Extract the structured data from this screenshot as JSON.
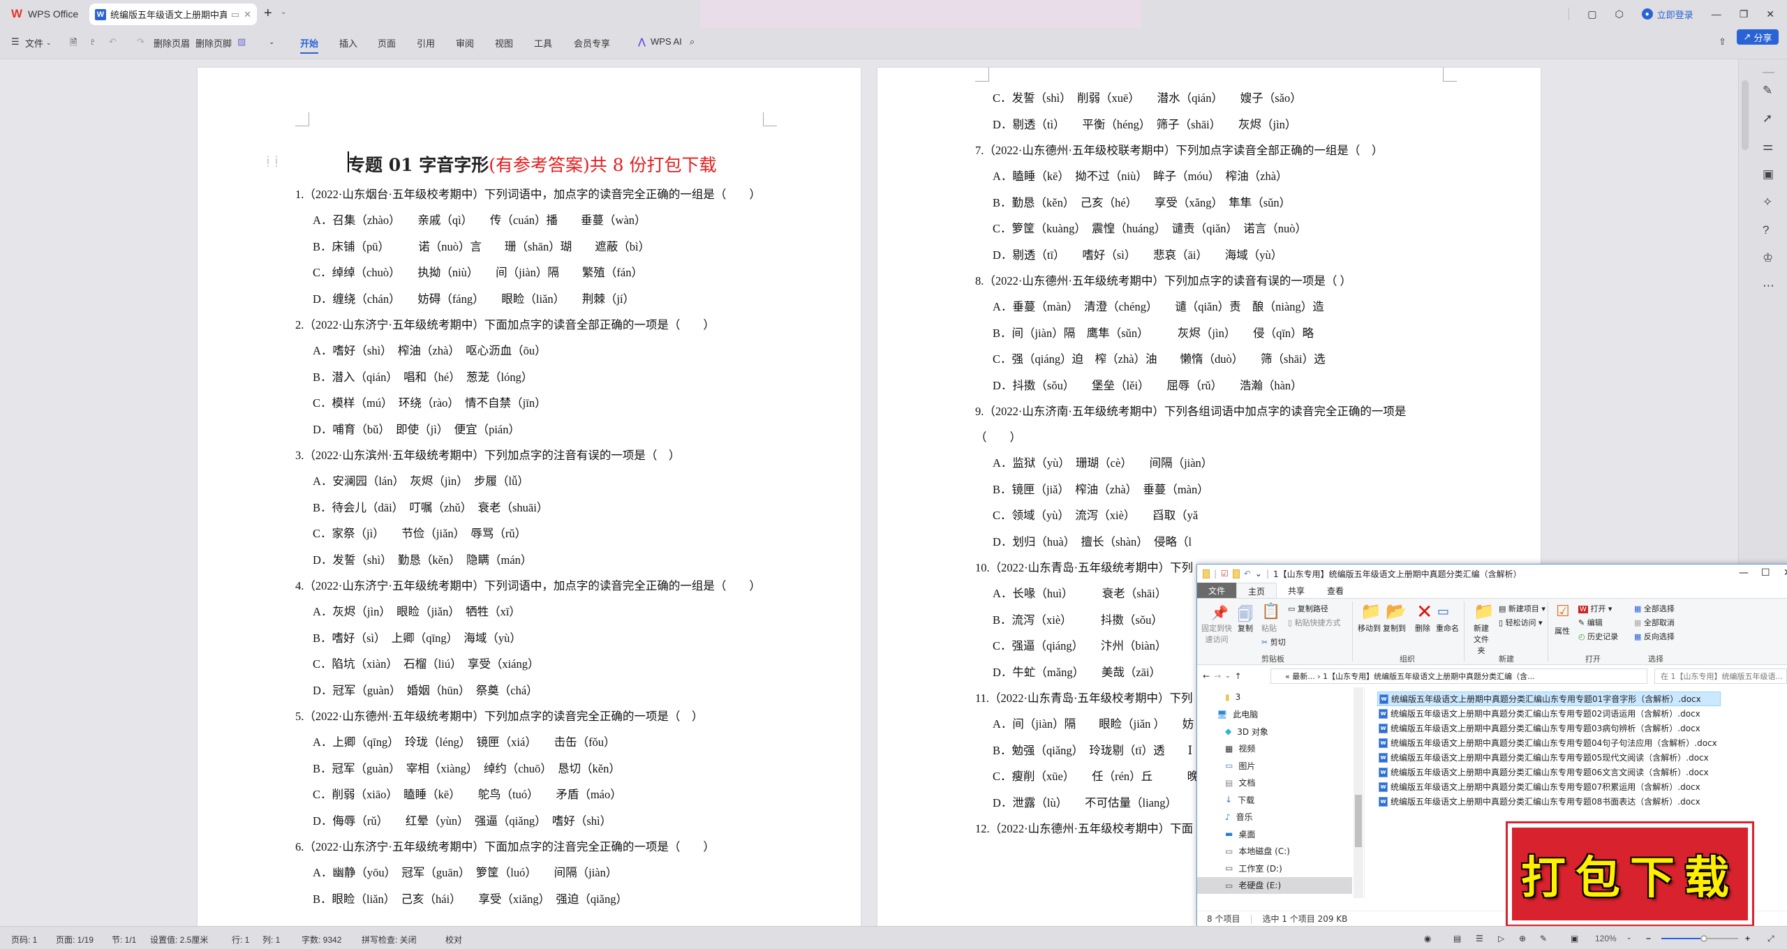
{
  "app": {
    "name": "WPS Office",
    "tab_title": "统编版五年级语文上册期中真题",
    "login_label": "立即登录",
    "share_label": "分享"
  },
  "toolbar": {
    "menu_file": "文件",
    "delete_header": "删除页眉",
    "delete_footer": "删除页脚",
    "tabs": [
      "开始",
      "插入",
      "页面",
      "引用",
      "审阅",
      "视图",
      "工具",
      "会员专享"
    ],
    "active_tab": "开始",
    "wps_ai": "WPS AI"
  },
  "document": {
    "title_black": "专题 01  字音字形",
    "title_red": "(有参考答案)共 8 份打包下载",
    "page1": [
      {
        "q": "1.（2022·山东烟台·五年级校考期中）下列词语中，加点字的读音完全正确的一组是（　　）",
        "options": [
          "A．召集（zhào）　　亲戚（qì）　　传（cuán）播　　垂蔓（wàn）",
          "B．床铺（pū）　　　诺（nuò）言　　珊（shān）瑚　　遮蔽（bì）",
          "C．绰绰（chuò）　　执拗（niù）　　间（jiàn）隔　　繁殖（fán）",
          "D．缠绕（chán）　　妨碍（fáng）　　眼睑（liǎn）　　荆棘（jí）"
        ]
      },
      {
        "q": "2.（2022·山东济宁·五年级统考期中）下面加点字的读音全部正确的一项是（　　）",
        "options": [
          "A．嗜好（shì）　榨油（zhà）　呕心沥血（ōu）",
          "B．潜入（qián）　唱和（hé）　葱茏（lóng）",
          "C．模样（mú）　环绕（rào）　情不自禁（jīn）",
          "D．哺育（bǔ）　即使（jì）　便宜（pián）"
        ]
      },
      {
        "q": "3.（2022·山东滨州·五年级统考期中）下列加点字的注音有误的一项是（　）",
        "options": [
          "A．安澜园（lán）　灰烬（jìn）　步履（lǚ）",
          "B．待会儿（dāi）　叮嘱（zhǔ）　衰老（shuāi）",
          "C．家祭（jì）　　节俭（jiǎn）　辱骂（rǔ）",
          "D．发誓（shì）　勤恳（kěn）　隐瞒（mán）"
        ]
      },
      {
        "q": "4.（2022·山东济宁·五年级统考期中）下列词语中，加点字的读音完全正确的一组是（　　）",
        "options": [
          "A．灰烬（jìn）　眼睑（jiǎn）　牺牲（xī）",
          "B．嗜好（sì）　上卿（qīng）　海域（yù）",
          "C．陷坑（xiàn）　石榴（liú）　享受（xiáng）",
          "D．冠军（guàn）　婚姻（hūn）　祭奠（chá）"
        ]
      },
      {
        "q": "5.（2022·山东德州·五年级统考期中）下列加点字的读音完全正确的一项是（　）",
        "options": [
          "A．上卿（qīng）　玲珑（léng）　镜匣（xiá）　　击缶（fǒu）",
          "B．冠军（guàn）　宰相（xiàng）　绰约（chuō）　恳切（kěn）",
          "C．削弱（xiāo）　瞌睡（kē）　　鸵鸟（tuó）　　矛盾（máo）",
          "D．侮辱（rǔ）　　红晕（yùn）　强逼（qiǎng）　嗜好（shì）"
        ]
      },
      {
        "q": "6.（2022·山东济宁·五年级统考期中）下面加点字的注音完全正确的一项是（　　）",
        "options": [
          "A．幽静（yōu）　冠军（guān）　箩筐（luó）　　间隔（jiàn）",
          "B．眼睑（liǎn）　己亥（hái）　　享受（xiǎng）　强迫（qiǎng）"
        ]
      }
    ],
    "page2_top": [
      "C．发誓（shì）　削弱（xuē）　　潜水（qián）　　嫂子（sǎo）",
      "D．剔透（tì）　　平衡（héng）　筛子（shāi）　　灰烬（jìn）"
    ],
    "page2": [
      {
        "q": "7.（2022·山东德州·五年级校联考期中）下列加点字读音全部正确的一组是（　）",
        "options": [
          "A．瞌睡（kē）　拗不过（niù）　眸子（móu）　榨油（zhà）",
          "B．勤恳（kěn）　己亥（hé）　　享受（xǎng）　隼隼（sǔn）",
          "C．箩筐（kuàng）　震惶（huáng）　谴责（qiǎn）　诺言（nuò）",
          "D．剔透（tī）　　嗜好（sì）　　悲哀（āi）　　海域（yù）"
        ]
      },
      {
        "q": "8.（2022·山东德州·五年级统考期中）下列加点字的读音有误的一项是（ ）",
        "options": [
          "A．垂蔓（màn）　清澄（chéng）　　谴（qiǎn）责　酿（niàng）造",
          "B．间（jiàn）隔　鹰隼（sǔn）　　　灰烬（jìn）　　侵（qīn）略",
          "C．强（qiáng）迫　榨（zhà）油　　懒惰（duò）　　筛（shāi）选",
          "D．抖擞（sǒu）　　堡垒（lěi）　　屈辱（rǔ）　　浩瀚（hàn）"
        ]
      },
      {
        "q": "9.（2022·山东济南·五年级统考期中）下列各组词语中加点字的读音完全正确的一项是",
        "q2": "（　　）",
        "options": [
          "A．监狱（yù）　珊瑚（cè）　　间隔（jiàn）",
          "B．镜匣（jiǎ）　榨油（zhà）　垂蔓（màn）",
          "C．领域（yù）　流泻（xiè）　　舀取（yǎ",
          "D．划归（huà）　擅长（shàn）　侵略（l"
        ]
      },
      {
        "q": "10.（2022·山东青岛·五年级统考期中）下列",
        "options": [
          "A．长喙（huì）　　　衰老（shāi）",
          "B．流泻（xiè）　　　抖擞（sǒu）",
          "C．强逼（qiáng）　　汴州（biàn）",
          "D．牛虻（mǎng）　　美哉（zāi）"
        ]
      },
      {
        "q": "11.（2022·山东青岛·五年级校考期中）下列",
        "options": [
          "A．间（jiàn）隔　　眼睑（jiǎn ）　　妨",
          "B．勉强（qiǎng）　玲珑剔（tī）透　　Ⅰ",
          "C．瘦削（xūe）　　任（rén）丘　　　晚",
          "D．泄露（lù）　　不可估量（liang）"
        ]
      },
      {
        "q": "12.（2022·山东德州·五年级校考期中）下面",
        "options": []
      }
    ]
  },
  "explorer": {
    "title": "1【山东专用】统编版五年级语文上册期中真题分类汇编（含解析）",
    "tabs": [
      "文件",
      "主页",
      "共享",
      "查看"
    ],
    "ribbon": {
      "pin": "固定到快速访问",
      "copy": "复制",
      "paste": "粘贴",
      "copy_path": "复制路径",
      "paste_shortcut": "粘贴快捷方式",
      "cut": "剪切",
      "group_clipboard": "剪贴板",
      "move_to": "移动到",
      "copy_to": "复制到",
      "delete": "删除",
      "rename": "重命名",
      "group_organize": "组织",
      "new_folder": "新建文件夹",
      "new_item": "新建项目",
      "easy_access": "轻松访问",
      "group_new": "新建",
      "properties": "属性",
      "open": "打开",
      "edit": "编辑",
      "history": "历史记录",
      "group_open": "打开",
      "select_all": "全部选择",
      "select_none": "全部取消",
      "invert_select": "反向选择",
      "group_select": "选择"
    },
    "address": "« 最新... › 1【山东专用】统编版五年级语文上册期中真题分类汇编（含...",
    "search_placeholder": "在 1【山东专用】统编版五年级语...",
    "nav": [
      "3",
      "此电脑",
      "3D 对象",
      "视频",
      "图片",
      "文档",
      "下载",
      "音乐",
      "桌面",
      "本地磁盘 (C:)",
      "工作室 (D:)",
      "老硬盘 (E:)"
    ],
    "nav_selected": "老硬盘 (E:)",
    "files": [
      "统编版五年级语文上册期中真题分类汇编山东专用专题01字音字形（含解析）.docx",
      "统编版五年级语文上册期中真题分类汇编山东专用专题02词语运用（含解析）.docx",
      "统编版五年级语文上册期中真题分类汇编山东专用专题03病句辨析（含解析）.docx",
      "统编版五年级语文上册期中真题分类汇编山东专用专题04句子句法应用（含解析）.docx",
      "统编版五年级语文上册期中真题分类汇编山东专用专题05现代文阅读（含解析）.docx",
      "统编版五年级语文上册期中真题分类汇编山东专用专题06文言文阅读（含解析）.docx",
      "统编版五年级语文上册期中真题分类汇编山东专用专题07积累运用（含解析）.docx",
      "统编版五年级语文上册期中真题分类汇编山东专用专题08书面表达（含解析）.docx"
    ],
    "status_count": "8 个项目",
    "status_selected": "选中 1 个项目  209 KB"
  },
  "stamp": {
    "text": "打包下载"
  },
  "statusbar": {
    "page_num": "页码: 1",
    "page": "页面: 1/19",
    "section": "节: 1/1",
    "setting": "设置值: 2.5厘米",
    "row": "行: 1",
    "col": "列: 1",
    "words": "字数: 9342",
    "spell": "拼写检查: 关闭",
    "proof": "校对",
    "zoom": "120%",
    "zoom_fraction": 0.55
  },
  "colors": {
    "accent": "#2a63d6",
    "title_red": "#e61c1c",
    "stamp_red": "#d8222e",
    "stamp_yellow": "#ffef00"
  }
}
